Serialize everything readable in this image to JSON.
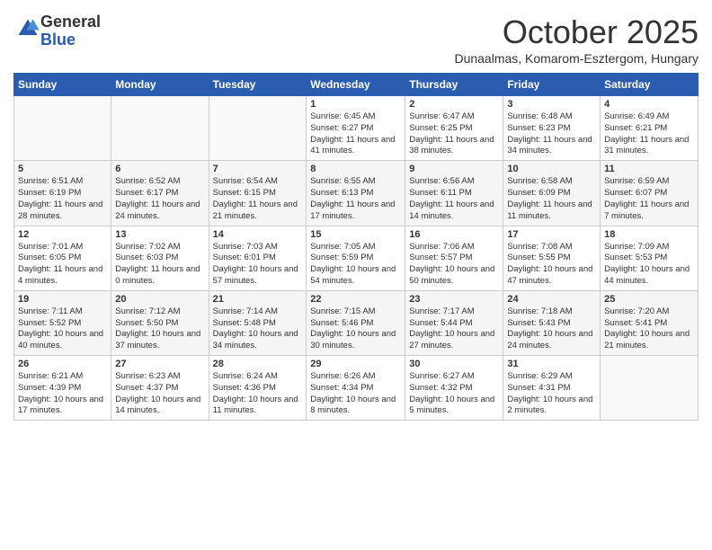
{
  "header": {
    "logo_general": "General",
    "logo_blue": "Blue",
    "month": "October 2025",
    "location": "Dunaalmas, Komarom-Esztergom, Hungary"
  },
  "weekdays": [
    "Sunday",
    "Monday",
    "Tuesday",
    "Wednesday",
    "Thursday",
    "Friday",
    "Saturday"
  ],
  "weeks": [
    [
      {
        "day": "",
        "info": ""
      },
      {
        "day": "",
        "info": ""
      },
      {
        "day": "",
        "info": ""
      },
      {
        "day": "1",
        "info": "Sunrise: 6:45 AM\nSunset: 6:27 PM\nDaylight: 11 hours\nand 41 minutes."
      },
      {
        "day": "2",
        "info": "Sunrise: 6:47 AM\nSunset: 6:25 PM\nDaylight: 11 hours\nand 38 minutes."
      },
      {
        "day": "3",
        "info": "Sunrise: 6:48 AM\nSunset: 6:23 PM\nDaylight: 11 hours\nand 34 minutes."
      },
      {
        "day": "4",
        "info": "Sunrise: 6:49 AM\nSunset: 6:21 PM\nDaylight: 11 hours\nand 31 minutes."
      }
    ],
    [
      {
        "day": "5",
        "info": "Sunrise: 6:51 AM\nSunset: 6:19 PM\nDaylight: 11 hours\nand 28 minutes."
      },
      {
        "day": "6",
        "info": "Sunrise: 6:52 AM\nSunset: 6:17 PM\nDaylight: 11 hours\nand 24 minutes."
      },
      {
        "day": "7",
        "info": "Sunrise: 6:54 AM\nSunset: 6:15 PM\nDaylight: 11 hours\nand 21 minutes."
      },
      {
        "day": "8",
        "info": "Sunrise: 6:55 AM\nSunset: 6:13 PM\nDaylight: 11 hours\nand 17 minutes."
      },
      {
        "day": "9",
        "info": "Sunrise: 6:56 AM\nSunset: 6:11 PM\nDaylight: 11 hours\nand 14 minutes."
      },
      {
        "day": "10",
        "info": "Sunrise: 6:58 AM\nSunset: 6:09 PM\nDaylight: 11 hours\nand 11 minutes."
      },
      {
        "day": "11",
        "info": "Sunrise: 6:59 AM\nSunset: 6:07 PM\nDaylight: 11 hours\nand 7 minutes."
      }
    ],
    [
      {
        "day": "12",
        "info": "Sunrise: 7:01 AM\nSunset: 6:05 PM\nDaylight: 11 hours\nand 4 minutes."
      },
      {
        "day": "13",
        "info": "Sunrise: 7:02 AM\nSunset: 6:03 PM\nDaylight: 11 hours\nand 0 minutes."
      },
      {
        "day": "14",
        "info": "Sunrise: 7:03 AM\nSunset: 6:01 PM\nDaylight: 10 hours\nand 57 minutes."
      },
      {
        "day": "15",
        "info": "Sunrise: 7:05 AM\nSunset: 5:59 PM\nDaylight: 10 hours\nand 54 minutes."
      },
      {
        "day": "16",
        "info": "Sunrise: 7:06 AM\nSunset: 5:57 PM\nDaylight: 10 hours\nand 50 minutes."
      },
      {
        "day": "17",
        "info": "Sunrise: 7:08 AM\nSunset: 5:55 PM\nDaylight: 10 hours\nand 47 minutes."
      },
      {
        "day": "18",
        "info": "Sunrise: 7:09 AM\nSunset: 5:53 PM\nDaylight: 10 hours\nand 44 minutes."
      }
    ],
    [
      {
        "day": "19",
        "info": "Sunrise: 7:11 AM\nSunset: 5:52 PM\nDaylight: 10 hours\nand 40 minutes."
      },
      {
        "day": "20",
        "info": "Sunrise: 7:12 AM\nSunset: 5:50 PM\nDaylight: 10 hours\nand 37 minutes."
      },
      {
        "day": "21",
        "info": "Sunrise: 7:14 AM\nSunset: 5:48 PM\nDaylight: 10 hours\nand 34 minutes."
      },
      {
        "day": "22",
        "info": "Sunrise: 7:15 AM\nSunset: 5:46 PM\nDaylight: 10 hours\nand 30 minutes."
      },
      {
        "day": "23",
        "info": "Sunrise: 7:17 AM\nSunset: 5:44 PM\nDaylight: 10 hours\nand 27 minutes."
      },
      {
        "day": "24",
        "info": "Sunrise: 7:18 AM\nSunset: 5:43 PM\nDaylight: 10 hours\nand 24 minutes."
      },
      {
        "day": "25",
        "info": "Sunrise: 7:20 AM\nSunset: 5:41 PM\nDaylight: 10 hours\nand 21 minutes."
      }
    ],
    [
      {
        "day": "26",
        "info": "Sunrise: 6:21 AM\nSunset: 4:39 PM\nDaylight: 10 hours\nand 17 minutes."
      },
      {
        "day": "27",
        "info": "Sunrise: 6:23 AM\nSunset: 4:37 PM\nDaylight: 10 hours\nand 14 minutes."
      },
      {
        "day": "28",
        "info": "Sunrise: 6:24 AM\nSunset: 4:36 PM\nDaylight: 10 hours\nand 11 minutes."
      },
      {
        "day": "29",
        "info": "Sunrise: 6:26 AM\nSunset: 4:34 PM\nDaylight: 10 hours\nand 8 minutes."
      },
      {
        "day": "30",
        "info": "Sunrise: 6:27 AM\nSunset: 4:32 PM\nDaylight: 10 hours\nand 5 minutes."
      },
      {
        "day": "31",
        "info": "Sunrise: 6:29 AM\nSunset: 4:31 PM\nDaylight: 10 hours\nand 2 minutes."
      },
      {
        "day": "",
        "info": ""
      }
    ]
  ]
}
